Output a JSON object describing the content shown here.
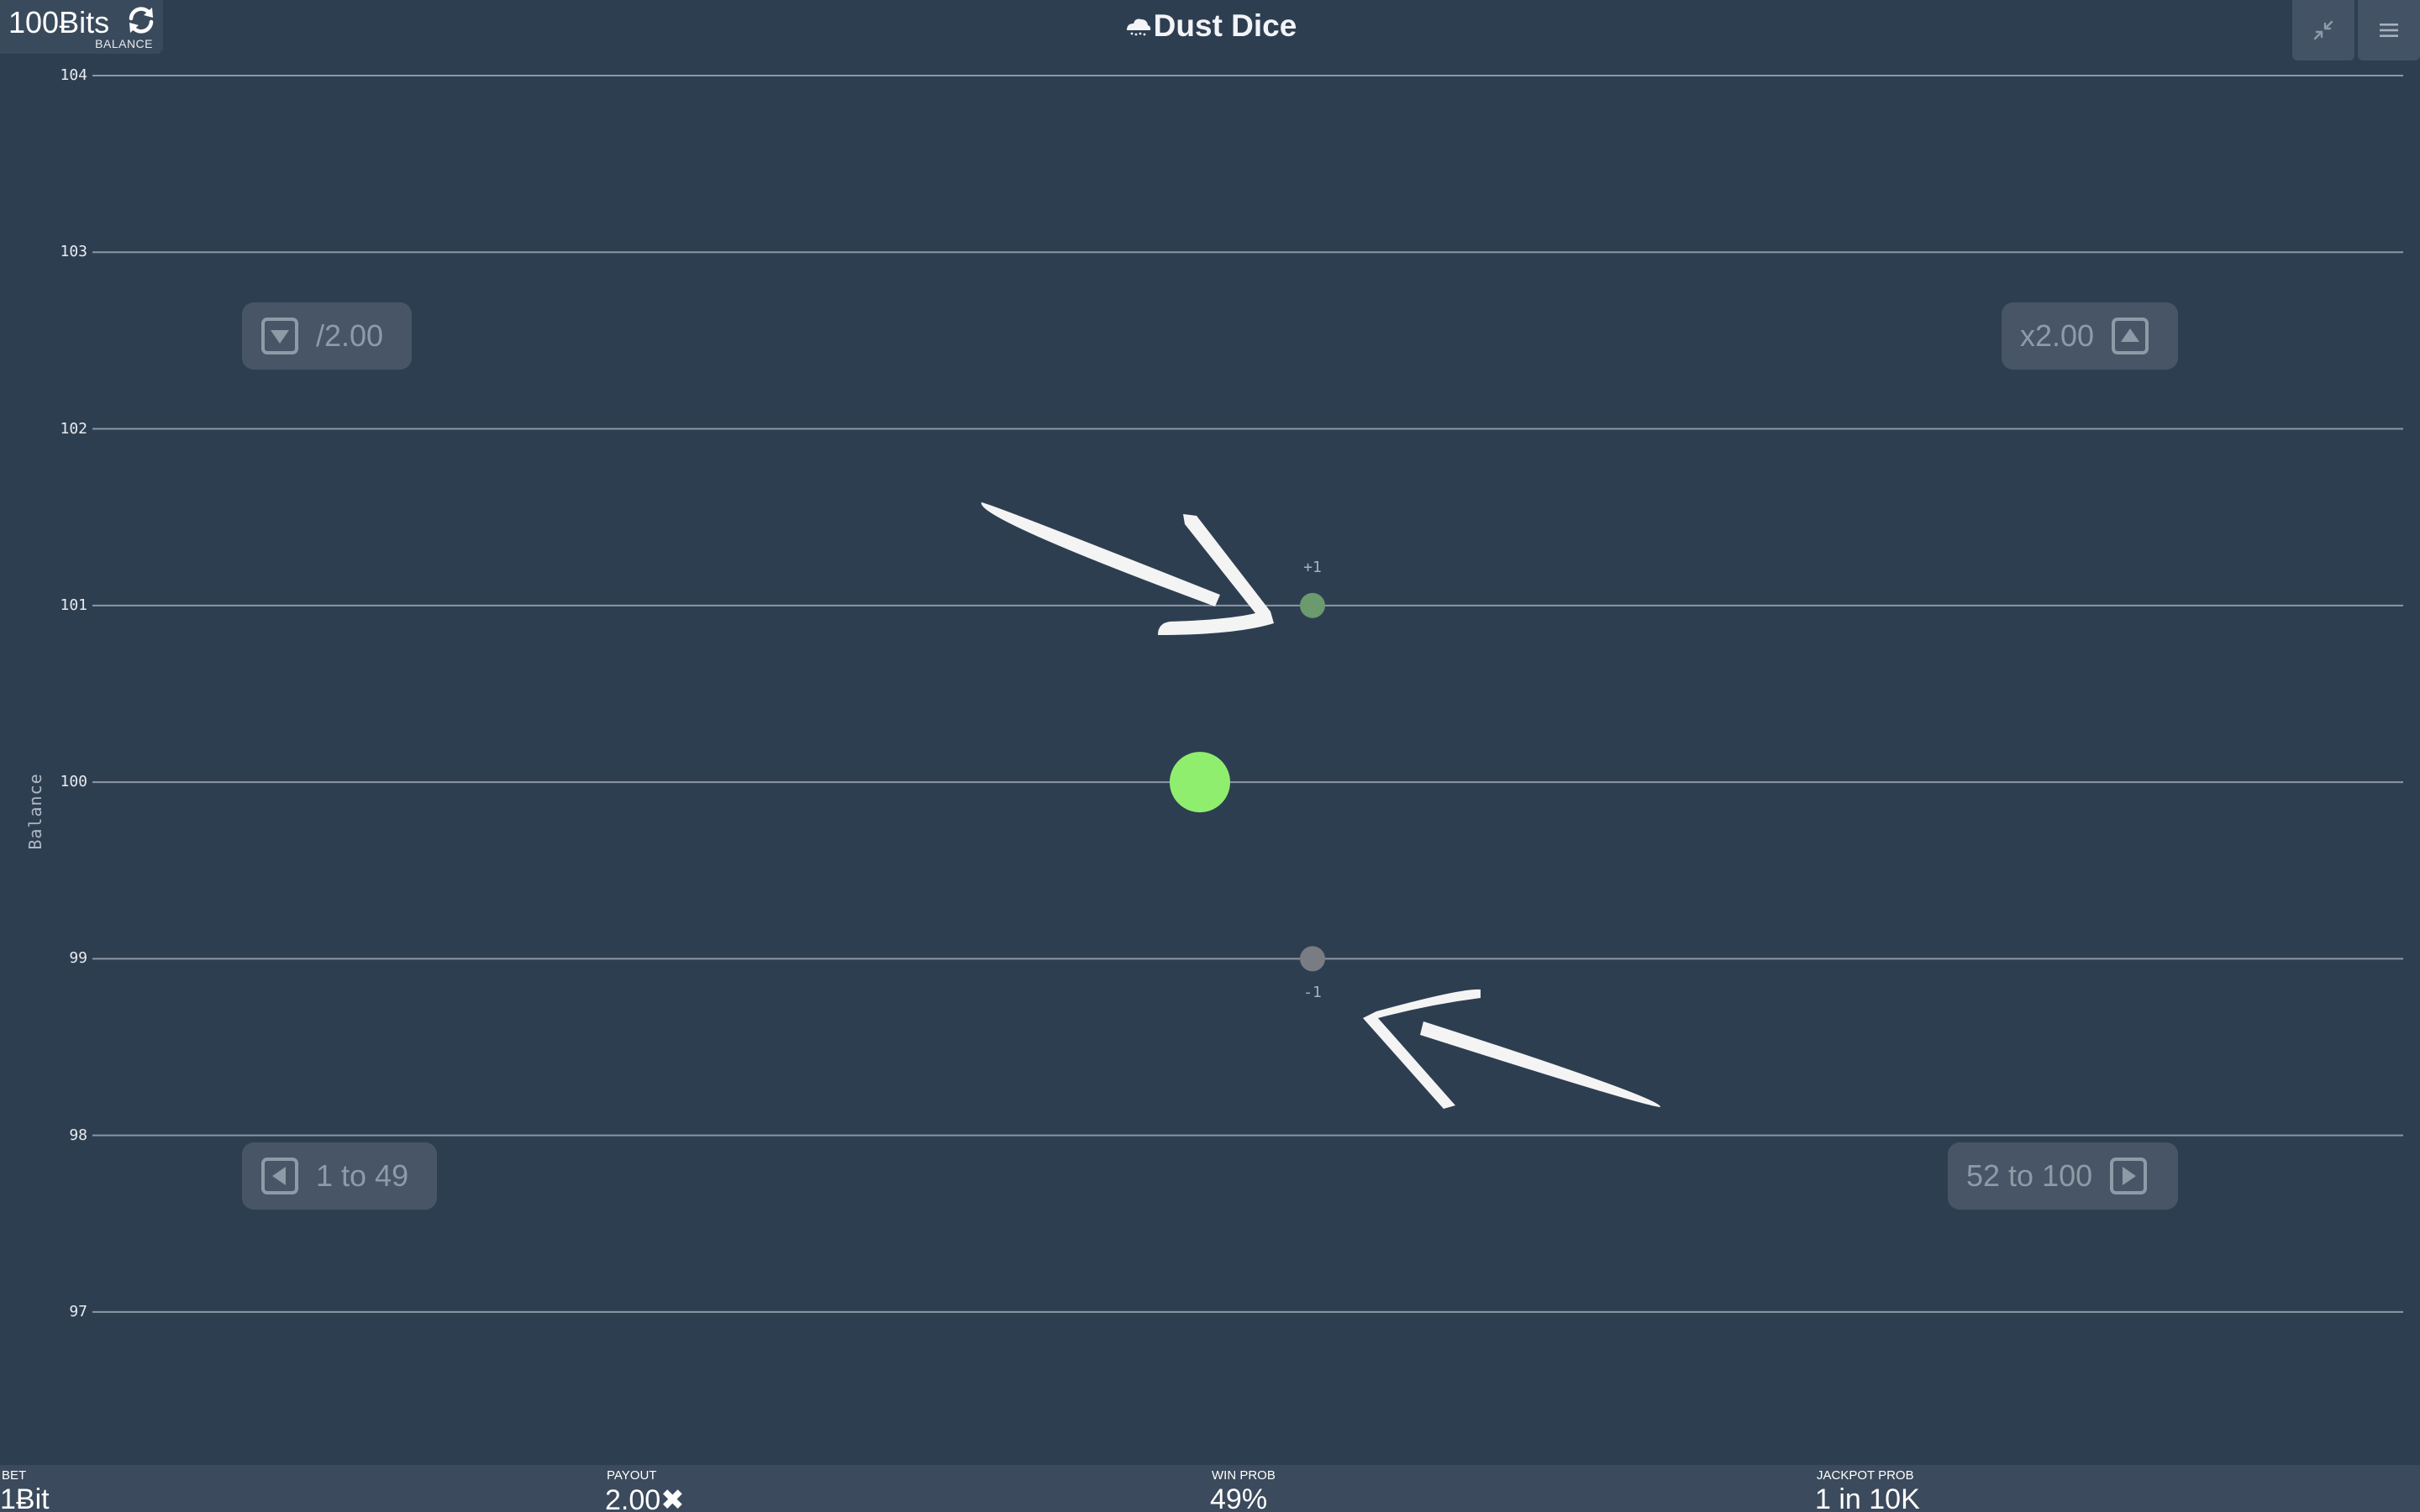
{
  "header": {
    "title": "Dust Dice",
    "balance": "100Ƀits",
    "balance_caption": "BALANCE"
  },
  "overlay_buttons": {
    "halve_label": "/2.00",
    "double_label": "x2.00",
    "low_range_label": "1 to 49",
    "high_range_label": "52 to 100"
  },
  "chart_data": {
    "type": "scatter",
    "ylabel": "Balance",
    "ylim": [
      96.7,
      104
    ],
    "yticks": [
      104,
      103,
      102,
      101,
      100,
      99,
      98,
      97
    ],
    "grid": true,
    "points": [
      {
        "role": "current",
        "y": 100,
        "color": "#90ee6e"
      },
      {
        "role": "win-preview",
        "y": 101,
        "color": "#6a9a6e",
        "label": "+1"
      },
      {
        "role": "loss-preview",
        "y": 99,
        "color": "#7a7c84",
        "label": "-1"
      }
    ]
  },
  "bottom": {
    "bet_label": "BET",
    "bet_value": "1Ƀit",
    "payout_label": "PAYOUT",
    "payout_value": "2.00✖",
    "winprob_label": "WIN PROB",
    "winprob_value": "49%",
    "jackpot_label": "JACKPOT PROB",
    "jackpot_value": "1 in 10K"
  },
  "colors": {
    "background": "#2e3e51",
    "gridline": "#8b97a5",
    "win_dot": "#90ee6e"
  },
  "icons": {
    "refresh": "refresh-icon",
    "compress": "compress-icon",
    "menu": "menu-icon",
    "arrow_down_box": "arrow-down-box-icon",
    "arrow_up_box": "arrow-up-box-icon",
    "arrow_left_box": "arrow-left-box-icon",
    "arrow_right_box": "arrow-right-box-icon"
  }
}
